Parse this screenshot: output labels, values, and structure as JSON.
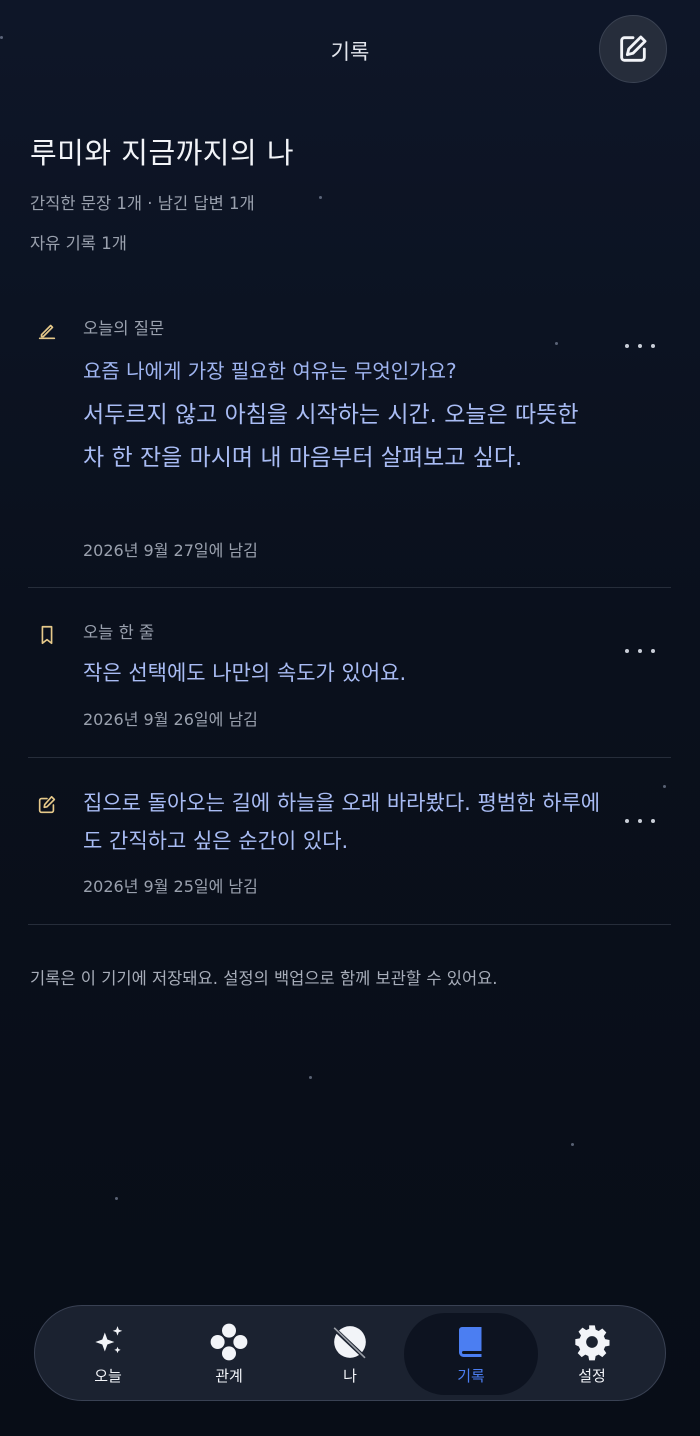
{
  "header": {
    "title": "기록"
  },
  "intro": {
    "title": "루미와 지금까지의 나",
    "stats_line1": "간직한 문장 1개 · 남긴 답변 1개",
    "stats_line2": "자유 기록 1개"
  },
  "entries": [
    {
      "icon": "pen-icon",
      "kicker": "오늘의 질문",
      "question": "요즘 나에게 가장 필요한 여유는 무엇인가요?",
      "body": "서두르지 않고 아침을 시작하는 시간. 오늘은 따뜻한 차 한 잔을 마시며 내 마음부터 살펴보고 싶다.",
      "date": "2026년 9월 27일에 남김"
    },
    {
      "icon": "bookmark-icon",
      "kicker": "오늘 한 줄",
      "body": "작은 선택에도 나만의 속도가 있어요.",
      "date": "2026년 9월 26일에 남김"
    },
    {
      "icon": "edit-note-icon",
      "body": "집으로 돌아오는 길에 하늘을 오래 바라봤다. 평범한 하루에도 간직하고 싶은 순간이 있다.",
      "date": "2026년 9월 25일에 남김"
    }
  ],
  "storage_note": "기록은 이 기기에 저장돼요. 설정의 백업으로 함께 보관할 수 있어요.",
  "tabs": [
    {
      "label": "오늘",
      "icon": "sparkles-icon"
    },
    {
      "label": "관계",
      "icon": "four-dots-icon"
    },
    {
      "label": "나",
      "icon": "planet-icon"
    },
    {
      "label": "기록",
      "icon": "book-icon",
      "active": true
    },
    {
      "label": "설정",
      "icon": "gear-icon"
    }
  ],
  "colors": {
    "accent": "#4b7ef2",
    "entry_text": "#a9bcf4",
    "icon_gold": "#e6c98a"
  }
}
